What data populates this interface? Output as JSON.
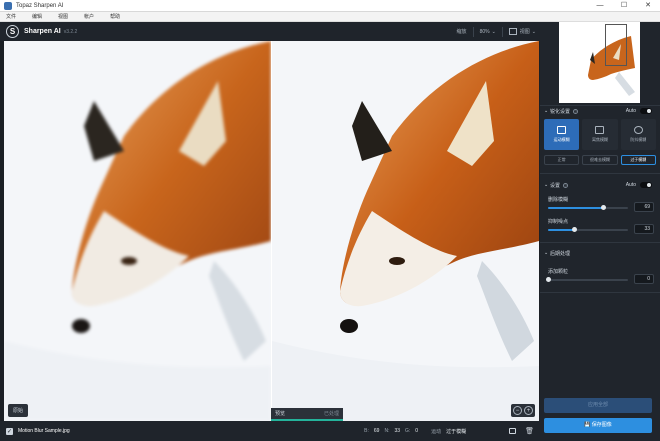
{
  "window": {
    "title": "Topaz Sharpen AI",
    "controls": [
      "—",
      "☐",
      "✕"
    ]
  },
  "menu": [
    "文件",
    "编辑",
    "视图",
    "帐户",
    "帮助"
  ],
  "header": {
    "app_name": "Sharpen AI",
    "version": "v3.2.2",
    "zoom_label": "缩放",
    "zoom_value": "80%",
    "view_label": "视图"
  },
  "viewport": {
    "original_label": "原始",
    "preview_tab": "预览",
    "processed_tab": "已处理",
    "zoom_in": "+",
    "zoom_out": "−"
  },
  "status": {
    "filename": "Motion Blur Sample.jpg",
    "b_label": "B:",
    "b_value": "69",
    "n_label": "N:",
    "n_value": "33",
    "g_label": "G:",
    "g_value": "0",
    "mode_label": "运动",
    "mode_value": "过于模糊"
  },
  "panel": {
    "section1": {
      "title": "锐化设置",
      "auto_label": "Auto",
      "modes": [
        {
          "label": "运动模糊",
          "active": true
        },
        {
          "label": "离焦模糊",
          "active": false
        },
        {
          "label": "防抖模糊",
          "active": false
        }
      ],
      "subs": [
        {
          "label": "正常",
          "active": false
        },
        {
          "label": "很难去模糊",
          "active": false
        },
        {
          "label": "过于模糊",
          "active": true
        }
      ]
    },
    "section2": {
      "title": "设置",
      "auto_label": "Auto",
      "slider1": {
        "label": "删除模糊",
        "value": "69",
        "fraction": 0.69
      },
      "slider2": {
        "label": "抑制噪点",
        "value": "33",
        "fraction": 0.33
      }
    },
    "section3": {
      "title": "后期处理",
      "slider1": {
        "label": "添加颗粒",
        "value": "0",
        "fraction": 0.0
      }
    },
    "apply_label": "应用全部",
    "save_label": "保存图像"
  },
  "colors": {
    "accent": "#2d8fe0",
    "active_mode": "#2d6cb8",
    "preview_bar": "#24b39b"
  }
}
